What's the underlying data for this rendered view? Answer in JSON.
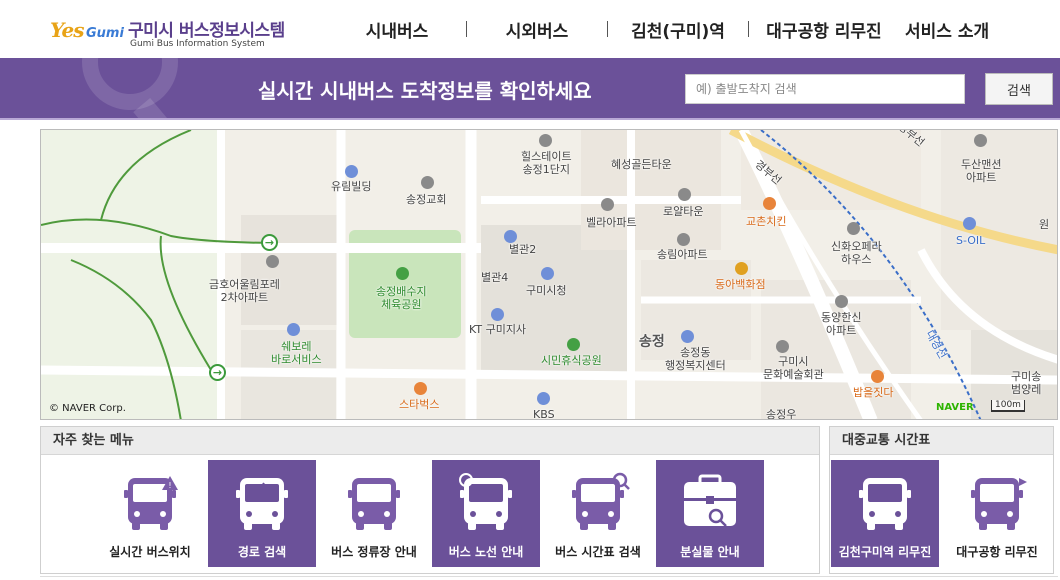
{
  "header": {
    "logo_yes": "Yes",
    "logo_gumi": "Gumi",
    "logo_title": "구미시 버스정보시스템",
    "logo_subtitle": "Gumi Bus Information System",
    "nav": [
      {
        "label": "시내버스"
      },
      {
        "label": "시외버스"
      },
      {
        "label": "김천(구미)역"
      },
      {
        "label": "대구공항 리무진"
      },
      {
        "label": "서비스 소개"
      }
    ]
  },
  "banner": {
    "headline": "실시간 시내버스 도착정보를 확인하세요",
    "search_placeholder": "예) 출발도착지 검색",
    "search_value": "",
    "search_button": "검색",
    "color": "#6b5199"
  },
  "map": {
    "provider": "NAVER",
    "copyright": "© NAVER Corp.",
    "scale": "100m",
    "labels": {
      "yurim": "유림빌딩",
      "songjeong_church": "송정교회",
      "hillstate": "힐스테이트\n송정1단지",
      "hyeseong": "혜성골든타운",
      "royal": "로얄타운",
      "bella": "벨라아파트",
      "kyochon": "교촌치킨",
      "duksan": "두산맨션\n아파트",
      "gyeongbu": "경부선",
      "shinhwa": "신화오페라\n하우스",
      "soil": "S-OIL",
      "annex2": "별관2",
      "annex4": "별관4",
      "cityhall": "구미시청",
      "songrim": "송림아파트",
      "donga": "동아백화점",
      "olympos": "금호어울림포레\n2차아파트",
      "gym": "송정배수지\n체육공원",
      "kt": "KT 구미지사",
      "chevrolet": "쉐보레\n바로서비스",
      "plaza": "시민휴식공원",
      "songjeong_dong": "송정동",
      "welfare": "송정동\n행정복지센터",
      "culture": "구미시\n문화예술회관",
      "dongyang": "동양한신\n아파트",
      "starbucks": "스타벅스",
      "kbs": "KBS",
      "bapeul": "밥을짓다",
      "daegyeong": "대경선",
      "hyeseong_right": "구미송\n범양레",
      "one": "원",
      "songjeong_partial": "송정우",
      "songjeong_big": "송정"
    }
  },
  "menu": {
    "title": "자주 찾는 메뉴",
    "items": [
      {
        "label": "실시간 버스위치",
        "icon": "bus-location-icon",
        "highlighted": false
      },
      {
        "label": "경로 검색",
        "icon": "route-search-icon",
        "highlighted": true
      },
      {
        "label": "버스 정류장 안내",
        "icon": "bus-stop-info-icon",
        "highlighted": false
      },
      {
        "label": "버스 노선 안내",
        "icon": "bus-route-info-icon",
        "highlighted": true
      },
      {
        "label": "버스 시간표 검색",
        "icon": "bus-timetable-search-icon",
        "highlighted": false
      },
      {
        "label": "분실물 안내",
        "icon": "lost-and-found-icon",
        "highlighted": true
      }
    ]
  },
  "timetable": {
    "title": "대중교통 시간표",
    "items": [
      {
        "label": "김천구미역 리무진",
        "icon": "limousine-bus-icon",
        "highlighted": true
      },
      {
        "label": "대구공항 리무진",
        "icon": "airport-limousine-icon",
        "highlighted": false
      }
    ]
  },
  "colors": {
    "brand_purple": "#6b5199",
    "icon_purple": "#7a5ca8",
    "map_road": "#ffffff",
    "map_park": "#cfe7c3",
    "map_rail": "#3a6ec8"
  }
}
